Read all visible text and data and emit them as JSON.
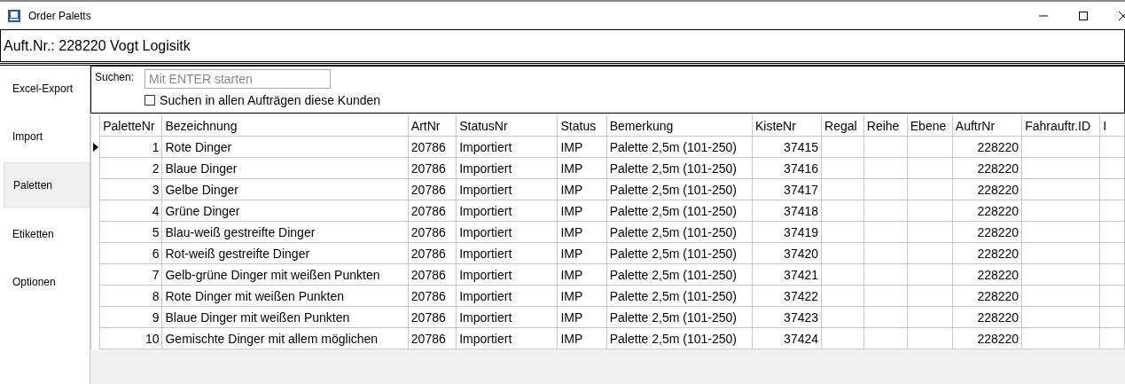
{
  "window": {
    "title": "Order Paletts"
  },
  "header": {
    "text": "Auft.Nr.: 228220 Vogt Logisitk"
  },
  "sidebar": {
    "items": [
      {
        "label": "Excel-Export",
        "selected": false
      },
      {
        "label": "Import",
        "selected": false
      },
      {
        "label": "Paletten",
        "selected": true
      },
      {
        "label": "Etiketten",
        "selected": false
      },
      {
        "label": "Optionen",
        "selected": false
      }
    ]
  },
  "search": {
    "label": "Suchen:",
    "placeholder": "Mit ENTER starten",
    "checkbox": {
      "label": "Suchen in allen Aufträgen diese Kunden",
      "checked": false
    }
  },
  "table": {
    "columns": [
      {
        "label": "PaletteNr"
      },
      {
        "label": "Bezeichnung"
      },
      {
        "label": "ArtNr"
      },
      {
        "label": "StatusNr"
      },
      {
        "label": "Status"
      },
      {
        "label": "Bemerkung"
      },
      {
        "label": "KisteNr"
      },
      {
        "label": "Regal"
      },
      {
        "label": "Reihe"
      },
      {
        "label": "Ebene"
      },
      {
        "label": "AuftrNr"
      },
      {
        "label": "Fahrauftr.ID"
      },
      {
        "label": "I"
      }
    ],
    "rows": [
      {
        "selected": true,
        "cells": [
          "1",
          "Rote Dinger",
          "20786",
          "Importiert",
          "IMP",
          "Palette 2,5m (101-250)",
          "37415",
          "",
          "",
          "",
          "228220",
          "",
          ""
        ]
      },
      {
        "selected": false,
        "cells": [
          "2",
          "Blaue Dinger",
          "20786",
          "Importiert",
          "IMP",
          "Palette 2,5m (101-250)",
          "37416",
          "",
          "",
          "",
          "228220",
          "",
          ""
        ]
      },
      {
        "selected": false,
        "cells": [
          "3",
          "Gelbe Dinger",
          "20786",
          "Importiert",
          "IMP",
          "Palette 2,5m (101-250)",
          "37417",
          "",
          "",
          "",
          "228220",
          "",
          ""
        ]
      },
      {
        "selected": false,
        "cells": [
          "4",
          "Grüne Dinger",
          "20786",
          "Importiert",
          "IMP",
          "Palette 2,5m (101-250)",
          "37418",
          "",
          "",
          "",
          "228220",
          "",
          ""
        ]
      },
      {
        "selected": false,
        "cells": [
          "5",
          "Blau-weiß gestreifte Dinger",
          "20786",
          "Importiert",
          "IMP",
          "Palette 2,5m (101-250)",
          "37419",
          "",
          "",
          "",
          "228220",
          "",
          ""
        ]
      },
      {
        "selected": false,
        "cells": [
          "6",
          "Rot-weiß gestreifte Dinger",
          "20786",
          "Importiert",
          "IMP",
          "Palette 2,5m (101-250)",
          "37420",
          "",
          "",
          "",
          "228220",
          "",
          ""
        ]
      },
      {
        "selected": false,
        "cells": [
          "7",
          "Gelb-grüne Dinger mit weißen Punkten",
          "20786",
          "Importiert",
          "IMP",
          "Palette 2,5m (101-250)",
          "37421",
          "",
          "",
          "",
          "228220",
          "",
          ""
        ]
      },
      {
        "selected": false,
        "cells": [
          "8",
          "Rote Dinger mit weißen Punkten",
          "20786",
          "Importiert",
          "IMP",
          "Palette 2,5m (101-250)",
          "37422",
          "",
          "",
          "",
          "228220",
          "",
          ""
        ]
      },
      {
        "selected": false,
        "cells": [
          "9",
          "Blaue Dinger mit weißen Punkten",
          "20786",
          "Importiert",
          "IMP",
          "Palette 2,5m (101-250)",
          "37423",
          "",
          "",
          "",
          "228220",
          "",
          ""
        ]
      },
      {
        "selected": false,
        "cells": [
          "10",
          "Gemischte Dinger mit allem möglichen",
          "20786",
          "Importiert",
          "IMP",
          "Palette 2,5m (101-250)",
          "37424",
          "",
          "",
          "",
          "228220",
          "",
          ""
        ]
      }
    ]
  }
}
